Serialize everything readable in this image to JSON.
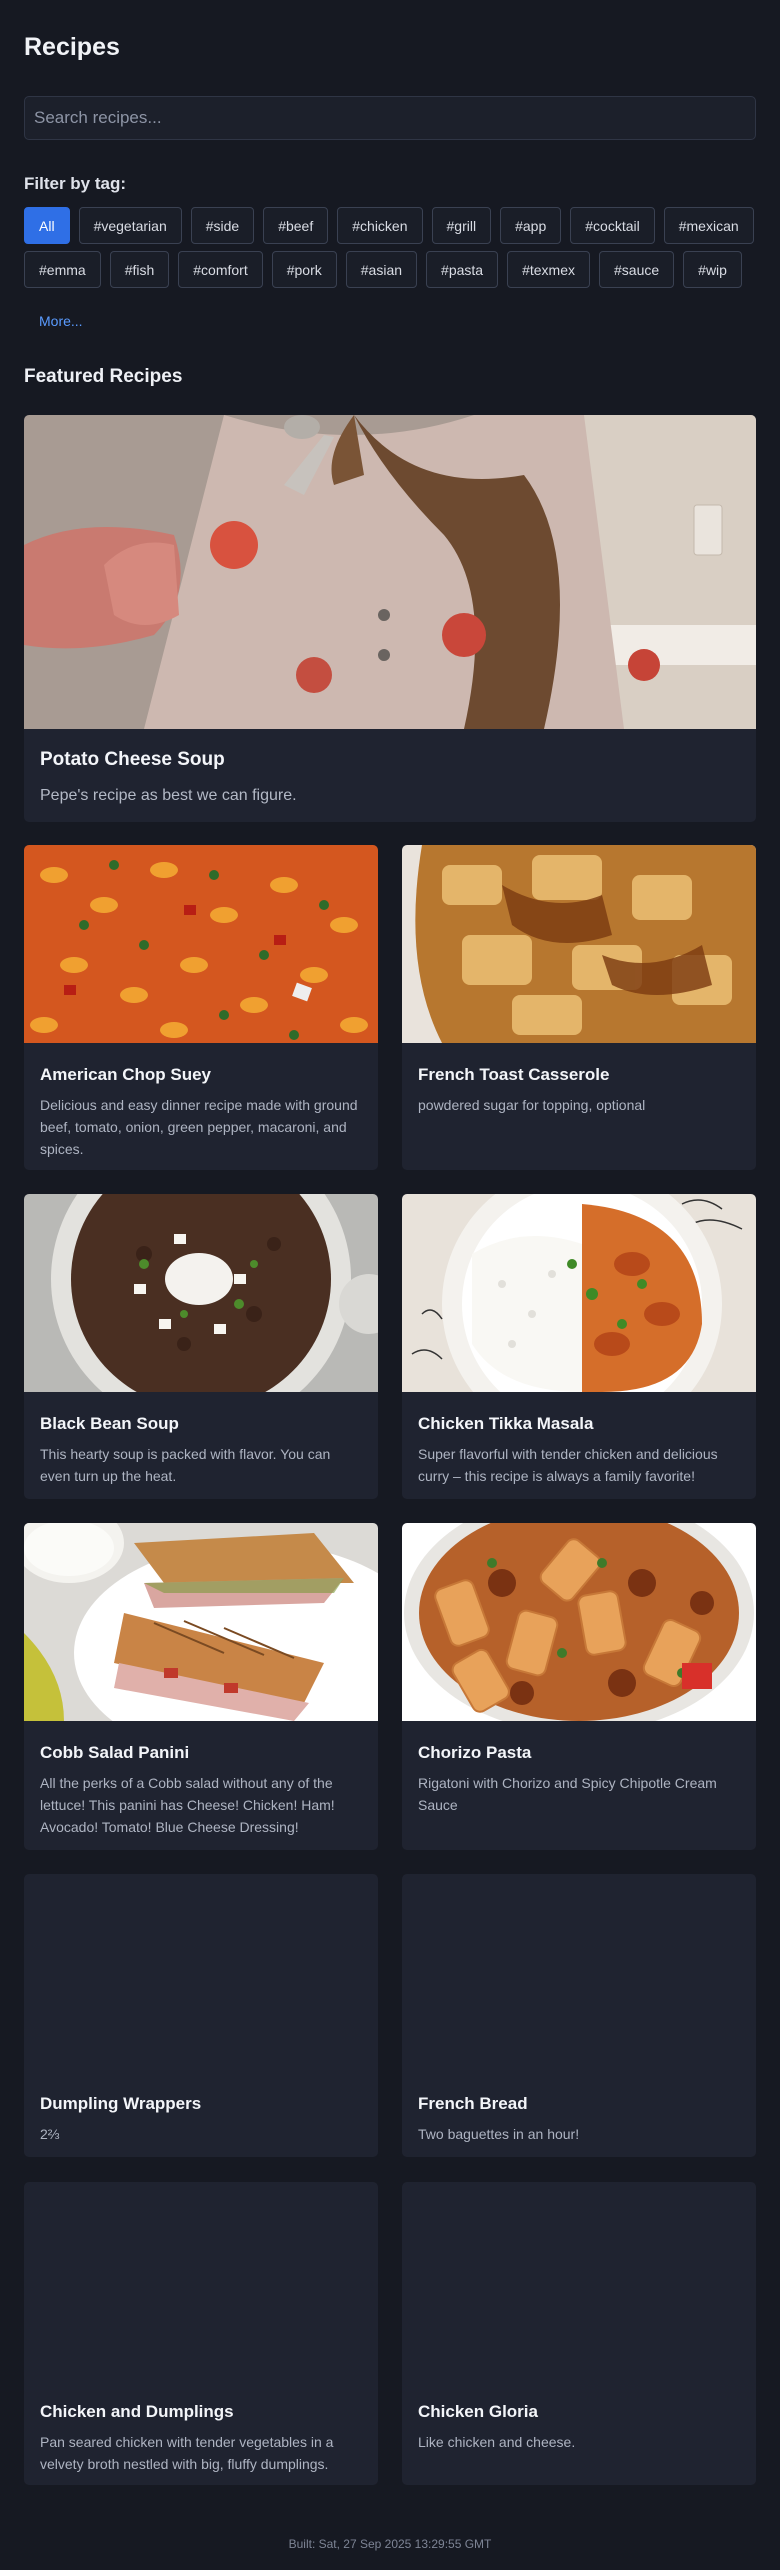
{
  "page": {
    "title": "Recipes",
    "search_placeholder": "Search recipes...",
    "filter_label": "Filter by tag:",
    "more_label": "More...",
    "featured_heading": "Featured Recipes",
    "footer": "Built: Sat, 27 Sep 2025 13:29:55 GMT"
  },
  "tags": [
    "All",
    "#vegetarian",
    "#side",
    "#beef",
    "#chicken",
    "#grill",
    "#app",
    "#cocktail",
    "#mexican",
    "#emma",
    "#fish",
    "#comfort",
    "#pork",
    "#asian",
    "#pasta",
    "#texmex",
    "#sauce",
    "#wip"
  ],
  "active_tag": "All",
  "hero": {
    "name": "Potato Cheese Soup",
    "description": "Pepe's recipe as best we can figure.",
    "image": "photo-child-eating-soup"
  },
  "recipes": [
    {
      "name": "American Chop Suey",
      "description": "Delicious and easy dinner recipe made with ground beef, tomato, onion, green pepper, macaroni, and spices.",
      "image": "photo-macaroni"
    },
    {
      "name": "French Toast Casserole",
      "description": "powdered sugar for topping, optional",
      "image": "photo-french-toast"
    },
    {
      "name": "Black Bean Soup",
      "description": "This hearty soup is packed with flavor. You can even turn up the heat.",
      "image": "photo-black-bean-soup"
    },
    {
      "name": "Chicken Tikka Masala",
      "description": "Super flavorful with tender chicken and delicious curry – this recipe is always a family favorite!",
      "image": "photo-tikka-masala"
    },
    {
      "name": "Cobb Salad Panini",
      "description": "All the perks of a Cobb salad without any of the lettuce! This panini has Cheese! Chicken! Ham! Avocado! Tomato! Blue Cheese Dressing!",
      "image": "photo-panini"
    },
    {
      "name": "Chorizo Pasta",
      "description": "Rigatoni with Chorizo and Spicy Chipotle Cream Sauce",
      "image": "photo-chorizo-pasta"
    },
    {
      "name": "Dumpling Wrappers",
      "description": "2⅔",
      "image": null
    },
    {
      "name": "French Bread",
      "description": "Two baguettes in an hour!",
      "image": null
    },
    {
      "name": "Chicken and Dumplings",
      "description": "Pan seared chicken with tender vegetables in a velvety broth nestled with big, fluffy dumplings.",
      "image": null
    },
    {
      "name": "Chicken Gloria",
      "description": "Like chicken and cheese.",
      "image": null
    }
  ],
  "colors": {
    "background": "#161922",
    "card": "#1f2330",
    "accent": "#2f6fe6",
    "link": "#5a9bff"
  }
}
